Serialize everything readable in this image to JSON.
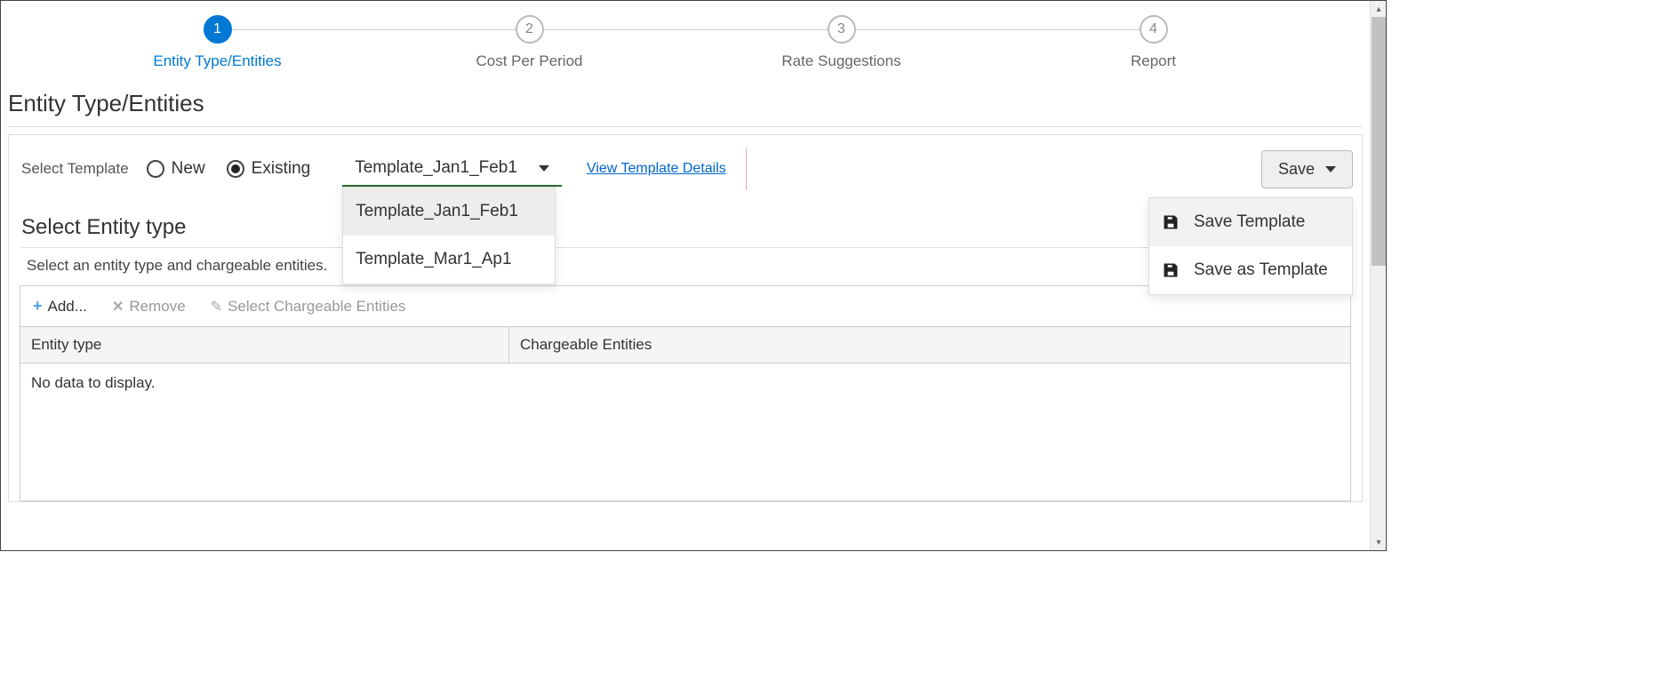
{
  "stepper": {
    "steps": [
      {
        "num": "1",
        "label": "Entity Type/Entities"
      },
      {
        "num": "2",
        "label": "Cost Per Period"
      },
      {
        "num": "3",
        "label": "Rate Suggestions"
      },
      {
        "num": "4",
        "label": "Report"
      }
    ]
  },
  "page_title": "Entity Type/Entities",
  "template": {
    "label": "Select Template",
    "radio_new": "New",
    "radio_existing": "Existing",
    "selected": "Template_Jan1_Feb1",
    "options": [
      "Template_Jan1_Feb1",
      "Template_Mar1_Ap1"
    ],
    "view_link": "View Template Details"
  },
  "save": {
    "button": "Save",
    "menu": [
      "Save Template",
      "Save as Template"
    ]
  },
  "section": {
    "title": "Select Entity type",
    "hint": "Select an entity type and chargeable entities."
  },
  "toolbar": {
    "add": "Add...",
    "remove": "Remove",
    "select_chargeable": "Select Chargeable Entities"
  },
  "table": {
    "col1": "Entity type",
    "col2": "Chargeable Entities",
    "empty": "No data to display."
  }
}
